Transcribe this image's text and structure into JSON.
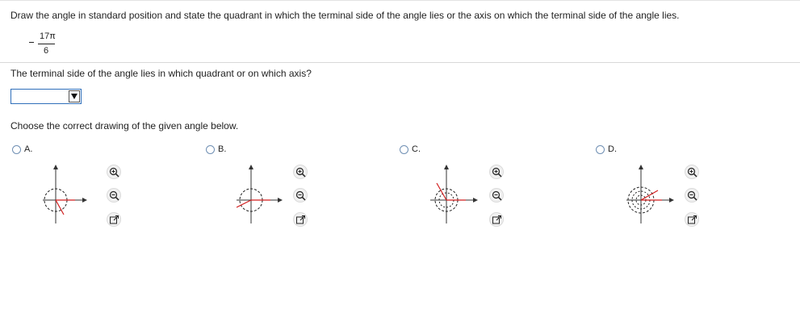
{
  "instruction": "Draw the angle in standard position and state the quadrant in which the terminal side of the angle lies or the axis on which the terminal side of the angle lies.",
  "angle": {
    "sign": "-",
    "numerator": "17π",
    "denominator": "6"
  },
  "question": "The terminal side of the angle lies in which quadrant or on which axis?",
  "dropdown": {
    "selected": "",
    "icon": "dropdown-arrow-icon"
  },
  "choose_prompt": "Choose the correct drawing of the given angle below.",
  "options": [
    {
      "label": "A.",
      "icons": [
        "zoom-in-icon",
        "zoom-out-icon",
        "open-new-window-icon"
      ]
    },
    {
      "label": "B.",
      "icons": [
        "zoom-in-icon",
        "zoom-out-icon",
        "open-new-window-icon"
      ]
    },
    {
      "label": "C.",
      "icons": [
        "zoom-in-icon",
        "zoom-out-icon",
        "open-new-window-icon"
      ]
    },
    {
      "label": "D.",
      "icons": [
        "zoom-in-icon",
        "zoom-out-icon",
        "open-new-window-icon"
      ]
    }
  ],
  "colors": {
    "terminal_side": "#d21f1f",
    "select_border": "#2f6fba",
    "radio": "#6f8fb3"
  }
}
